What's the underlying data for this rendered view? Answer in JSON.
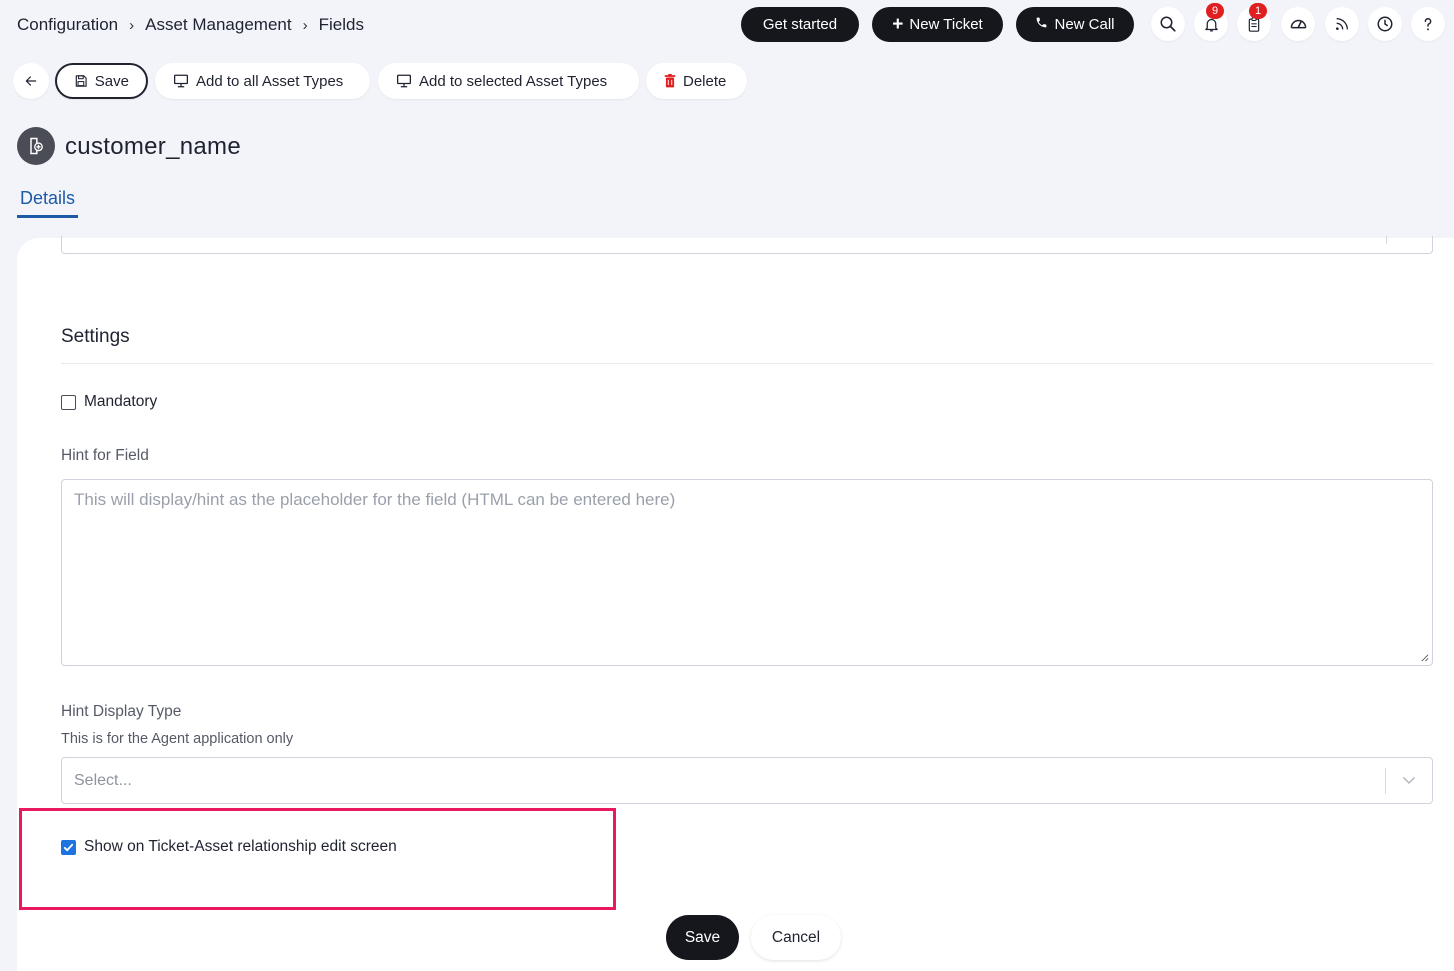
{
  "breadcrumb": [
    "Configuration",
    "Asset Management",
    "Fields"
  ],
  "header": {
    "get_started": "Get started",
    "new_ticket": "New Ticket",
    "new_call": "New Call",
    "notifications_badge": "9",
    "tasks_badge": "1"
  },
  "toolbar": {
    "save": "Save",
    "add_all": "Add to all Asset Types",
    "add_selected": "Add to selected Asset Types",
    "delete": "Delete"
  },
  "page": {
    "title": "customer_name",
    "tab_details": "Details"
  },
  "settings": {
    "section_title": "Settings",
    "mandatory_label": "Mandatory",
    "mandatory_checked": false,
    "hint_label": "Hint for Field",
    "hint_placeholder": "This will display/hint as the placeholder for the field (HTML can be entered here)",
    "hint_display_label": "Hint Display Type",
    "hint_display_sub": "This is for the Agent application only",
    "hint_display_placeholder": "Select...",
    "show_on_label": "Show on Ticket-Asset relationship edit screen",
    "show_on_checked": true
  },
  "footer": {
    "save": "Save",
    "cancel": "Cancel"
  },
  "colors": {
    "accent": "#1c5aa8",
    "dark_button": "#15171c",
    "highlight": "#e8195f",
    "badge": "#e02020",
    "checkbox": "#1f73e0"
  }
}
